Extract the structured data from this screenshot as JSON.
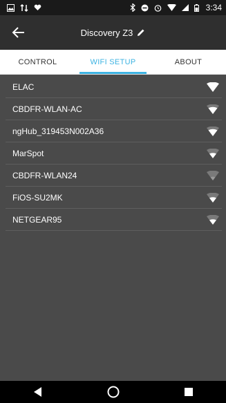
{
  "status_bar": {
    "left_icons": [
      "image-icon",
      "transfer-icon",
      "heart-icon"
    ],
    "right_icons": [
      "bluetooth-icon",
      "dnd-icon",
      "alarm-icon",
      "wifi-status-icon",
      "signal-icon",
      "battery-icon"
    ],
    "time": "3:34"
  },
  "app_bar": {
    "title": "Discovery Z3"
  },
  "tabs": [
    {
      "label": "CONTROL",
      "active": false
    },
    {
      "label": "WIFI SETUP",
      "active": true
    },
    {
      "label": "ABOUT",
      "active": false
    }
  ],
  "networks": [
    {
      "ssid": "ELAC"
    },
    {
      "ssid": "CBDFR-WLAN-AC"
    },
    {
      "ssid": "ngHub_319453N002A36"
    },
    {
      "ssid": "MarSpot"
    },
    {
      "ssid": "CBDFR-WLAN24"
    },
    {
      "ssid": "FiOS-SU2MK"
    },
    {
      "ssid": "NETGEAR95"
    }
  ],
  "colors": {
    "accent": "#3db3e2",
    "background": "#4a4a4a",
    "appbar": "#2f2f2f"
  }
}
